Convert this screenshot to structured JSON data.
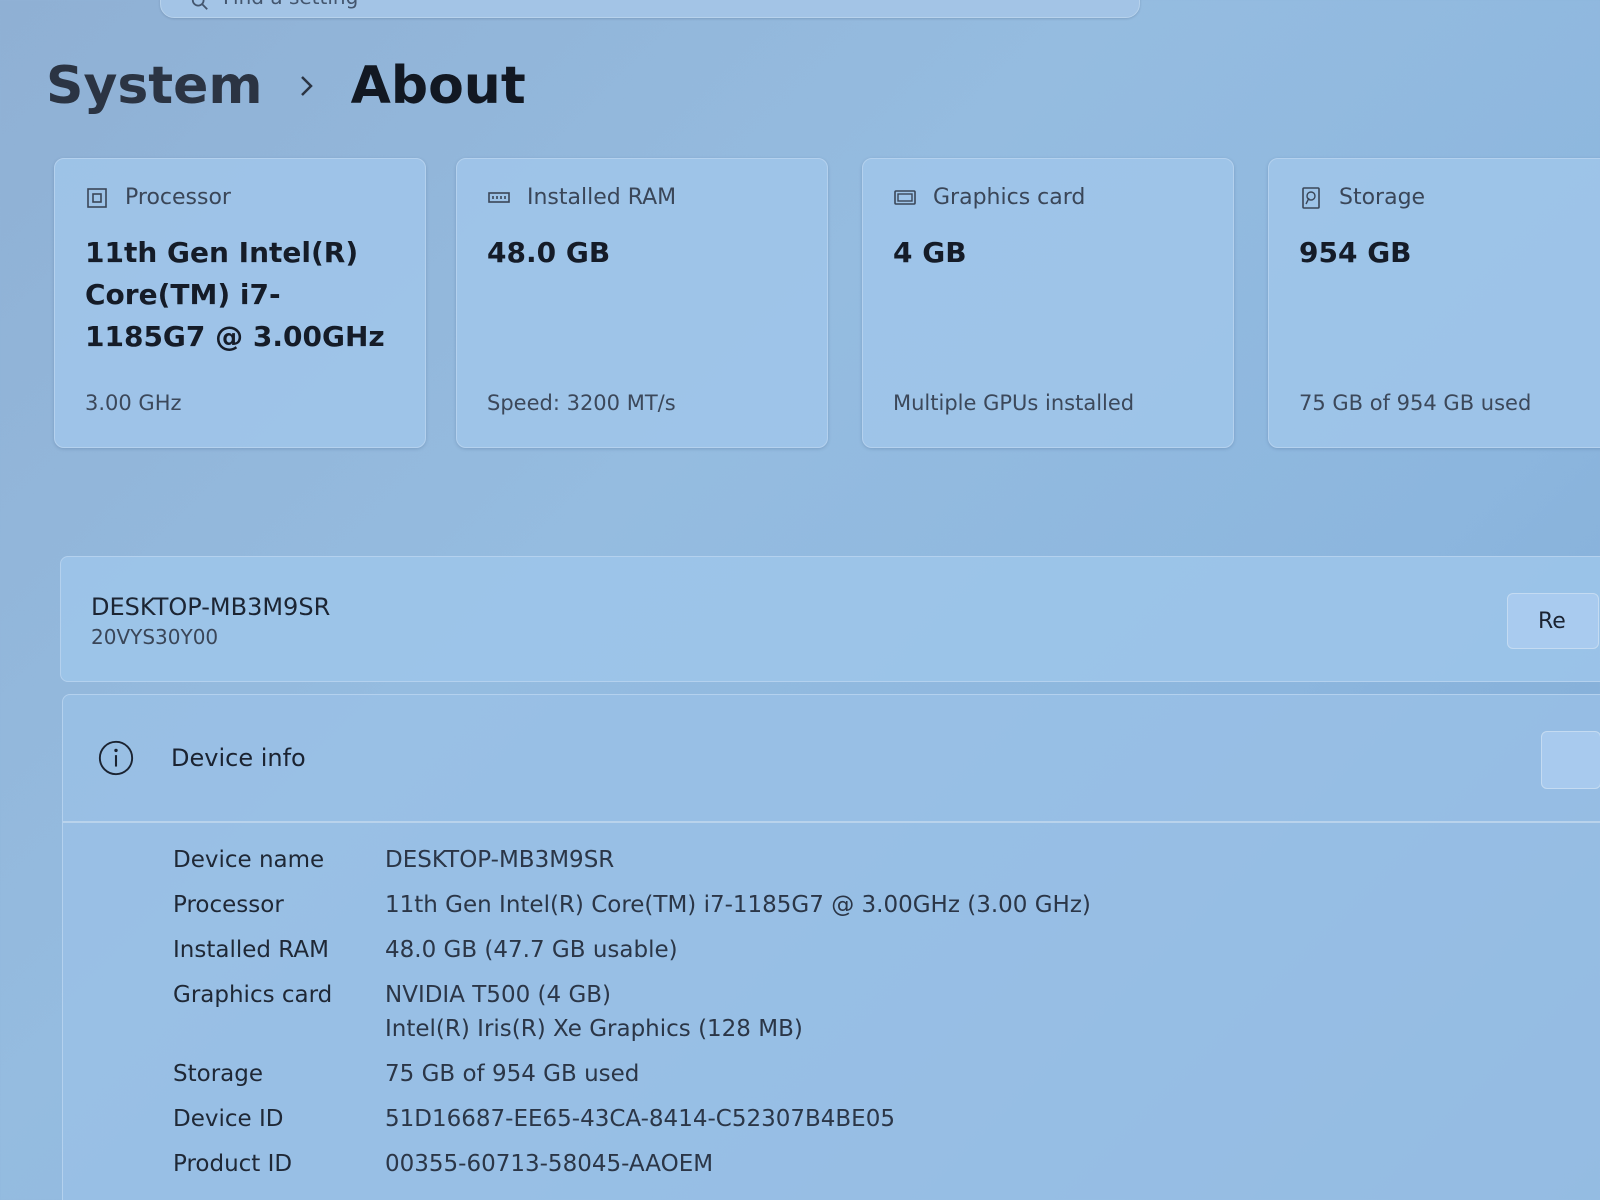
{
  "search": {
    "text": "Find a setting"
  },
  "breadcrumb": {
    "parent": "System",
    "current": "About"
  },
  "cards": [
    {
      "icon": "processor-icon",
      "title": "Processor",
      "value": "11th Gen Intel(R) Core(TM) i7-1185G7 @ 3.00GHz",
      "sub": "3.00 GHz"
    },
    {
      "icon": "ram-icon",
      "title": "Installed RAM",
      "value": "48.0 GB",
      "sub": "Speed: 3200 MT/s"
    },
    {
      "icon": "graphics-card-icon",
      "title": "Graphics card",
      "value": "4 GB",
      "sub": "Multiple GPUs installed"
    },
    {
      "icon": "storage-icon",
      "title": "Storage",
      "value": "954 GB",
      "sub": "75 GB of 954 GB used"
    }
  ],
  "device_bar": {
    "name": "DESKTOP-MB3M9SR",
    "model": "20VYS30Y00",
    "rename_label": "Re"
  },
  "device_info": {
    "title": "Device info",
    "rows": [
      {
        "label": "Device name",
        "value": "DESKTOP-MB3M9SR"
      },
      {
        "label": "Processor",
        "value": "11th Gen Intel(R) Core(TM) i7-1185G7 @ 3.00GHz (3.00 GHz)"
      },
      {
        "label": "Installed RAM",
        "value": "48.0 GB (47.7 GB usable)"
      },
      {
        "label": "Graphics card",
        "value": "NVIDIA T500 (4 GB)",
        "value2": "Intel(R) Iris(R) Xe Graphics (128 MB)"
      },
      {
        "label": "Storage",
        "value": "75 GB of 954 GB used"
      },
      {
        "label": "Device ID",
        "value": "51D16687-EE65-43CA-8414-C52307B4BE05"
      },
      {
        "label": "Product ID",
        "value": "00355-60713-58045-AAOEM"
      }
    ]
  }
}
